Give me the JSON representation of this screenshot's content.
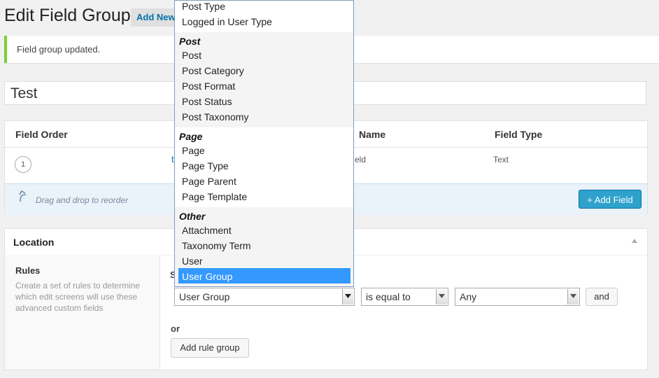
{
  "header": {
    "title": "Edit Field Group",
    "add_new": "Add New"
  },
  "notice": {
    "text": "Field group updated."
  },
  "title_field": {
    "value": "Test"
  },
  "fields_table": {
    "columns": [
      "Field Order",
      "Name",
      "Field Type"
    ],
    "rows": [
      {
        "order": "1",
        "label_fragment": "t",
        "name_fragment": "eld",
        "type": "Text"
      }
    ],
    "footer_hint": "Drag and drop to reorder",
    "add_button": "+ Add Field"
  },
  "location": {
    "title": "Location",
    "rules_title": "Rules",
    "rules_desc": "Create a set of rules to determine which edit screens will use these advanced custom fields",
    "show_label_fragment": "S",
    "rule": {
      "param": "User Group",
      "operator": "is equal to",
      "value": "Any"
    },
    "and_button": "and",
    "or_label": "or",
    "add_rule_group": "Add rule group"
  },
  "dropdown": {
    "top_items": [
      "Post Type",
      "Logged in User Type"
    ],
    "groups": [
      {
        "label": "Post",
        "items": [
          "Post",
          "Post Category",
          "Post Format",
          "Post Status",
          "Post Taxonomy"
        ]
      },
      {
        "label": "Page",
        "items": [
          "Page",
          "Page Type",
          "Page Parent",
          "Page Template"
        ]
      },
      {
        "label": "Other",
        "items": [
          "Attachment",
          "Taxonomy Term",
          "User",
          "User Group"
        ]
      }
    ],
    "selected": "User Group"
  },
  "colors": {
    "accent": "#2ea2cc",
    "notice_border": "#7ad03a",
    "selection": "#3399ff"
  }
}
